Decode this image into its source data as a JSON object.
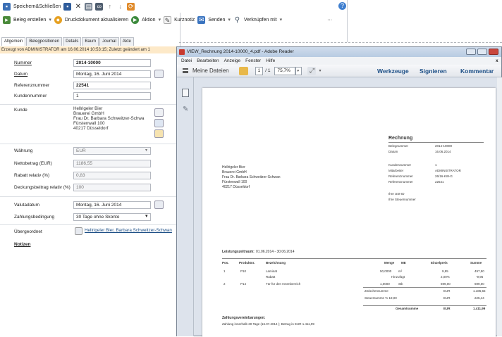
{
  "toolbar1": {
    "save_close": "Speichern&Schließen",
    "icons": [
      "save-icon",
      "close-icon",
      "print-icon",
      "binoculars-icon",
      "arrow-up-icon",
      "arrow-down-icon",
      "refresh-icon"
    ],
    "help_icon": "help-icon"
  },
  "toolbar2": {
    "beleg_erstellen": "Beleg erstellen",
    "druckdokument": "Druckdokument aktualisieren",
    "aktion": "Aktion",
    "kurznotiz": "Kurznotiz",
    "senden": "Senden",
    "verknuepfen": "Verknüpfen mit",
    "more": "···"
  },
  "tabs": [
    "Allgemein",
    "Belegpositionen",
    "Details",
    "Baum",
    "Journal",
    "Akte"
  ],
  "info_bar": "Erzeugt von ADMINISTRATOR am 16.06.2014 10:53:15; Zuletzt geändert am 1",
  "form": {
    "nummer_label": "Nummer",
    "nummer_value": "2014-10000",
    "datum_label": "Datum",
    "datum_value": "Montag, 16. Juni 2014",
    "referenz_label": "Referenznummer",
    "referenz_value": "22541",
    "kundennr_label": "Kundennummer",
    "kundennr_value": "1",
    "kunde_label": "Kunde",
    "kunde_lines": [
      "Hellrigeler Bier",
      "Brauerei GmbH",
      "Frau Dr. Barbara Schweitzer-Schwa",
      "Fürstenwall 100",
      "40217 Düsseldorf"
    ],
    "waehrung_label": "Währung",
    "waehrung_value": "EUR",
    "netto_label": "Nettobetrag (EUR)",
    "netto_value": "1186,55",
    "rabatt_label": "Rabatt relativ (%)",
    "rabatt_value": "0,83",
    "deckung_label": "Deckungsbeitrag relativ (%)",
    "deckung_value": "100",
    "valuta_label": "Valutadatum",
    "valuta_value": "Montag, 16. Juni 2014",
    "zahlung_label": "Zahlungsbedingung",
    "zahlung_value": "30 Tage ohne Skonto",
    "ueber_label": "Übergeordnet",
    "ueber_value": "Hellrigeler Bier, Barbara Schweitzer-Schwan",
    "notizen_label": "Notizen"
  },
  "reader": {
    "title": "VIEW_Rechnung 2014-10000_4.pdf - Adobe Reader",
    "menu": [
      "Datei",
      "Bearbeiten",
      "Anzeige",
      "Fenster",
      "Hilfe"
    ],
    "meine_dateien": "Meine Dateien",
    "page_current": "1",
    "page_total": "/ 1",
    "zoom": "75,7%",
    "werkzeuge": "Werkzeuge",
    "signieren": "Signieren",
    "kommentar": "Kommentar"
  },
  "invoice": {
    "heading": "Rechnung",
    "meta": [
      [
        "Belegnummer",
        "2014-10000"
      ],
      [
        "Datum",
        "16.06.2014"
      ],
      [
        "Kundennummer",
        "1"
      ],
      [
        "Mitarbeiter",
        "ADMINISTRATOR"
      ],
      [
        "Referenznummer",
        "26/16-KW-G"
      ],
      [
        "Referenznummer",
        "22541"
      ],
      [
        "Ihre USt-ID",
        ""
      ],
      [
        "Ihre Steuernummer",
        ""
      ]
    ],
    "address": [
      "Hellrigeler Bier",
      "Brauerei GmbH",
      "Frau Dr. Barbara Schweitzer-Schwan",
      "Fürstenwall 100",
      "40217 Düsseldorf"
    ],
    "leistungszeitraum_label": "Leistungszeitraum:",
    "leistungszeitraum": "01.06.2014 - 30.06.2014",
    "columns": [
      "Pos.",
      "Produktnr.",
      "Bezeichnung",
      "Menge",
      "ME",
      "Einzelpreis",
      "Summe"
    ],
    "rows": [
      [
        "1",
        "P10",
        "Laminat",
        "50,0000",
        "m²",
        "9,95",
        "497,50"
      ],
      [
        "",
        "",
        "Rabatt",
        "",
        "Hinzufügt",
        "2,00%",
        "-9,95"
      ],
      [
        "2",
        "P14",
        "Tür für den Innenbereich",
        "1,0000",
        "Stk",
        "699,00",
        "699,00"
      ]
    ],
    "zwischensumme_label": "Zwischensumme",
    "zwischensumme_cur": "EUR",
    "zwischensumme": "1.186,55",
    "steuer_label": "Steuersumme % 19,00",
    "steuer_cur": "EUR",
    "steuer": "225,44",
    "gesamt_label": "Gesamtsumme",
    "gesamt_cur": "EUR",
    "gesamt": "1.411,99",
    "zahlung_heading": "Zahlungsvereinbarungen:",
    "zahlung_text": "Zahlung innerhalb 30 Tage (16.07.2014 ); Betrag in EUR 1.411,99"
  },
  "colors": {
    "accent": "#1d4f86",
    "info_bg": "#fde9c8",
    "title_bar": "#c4d4e8",
    "close": "#c9463d"
  }
}
